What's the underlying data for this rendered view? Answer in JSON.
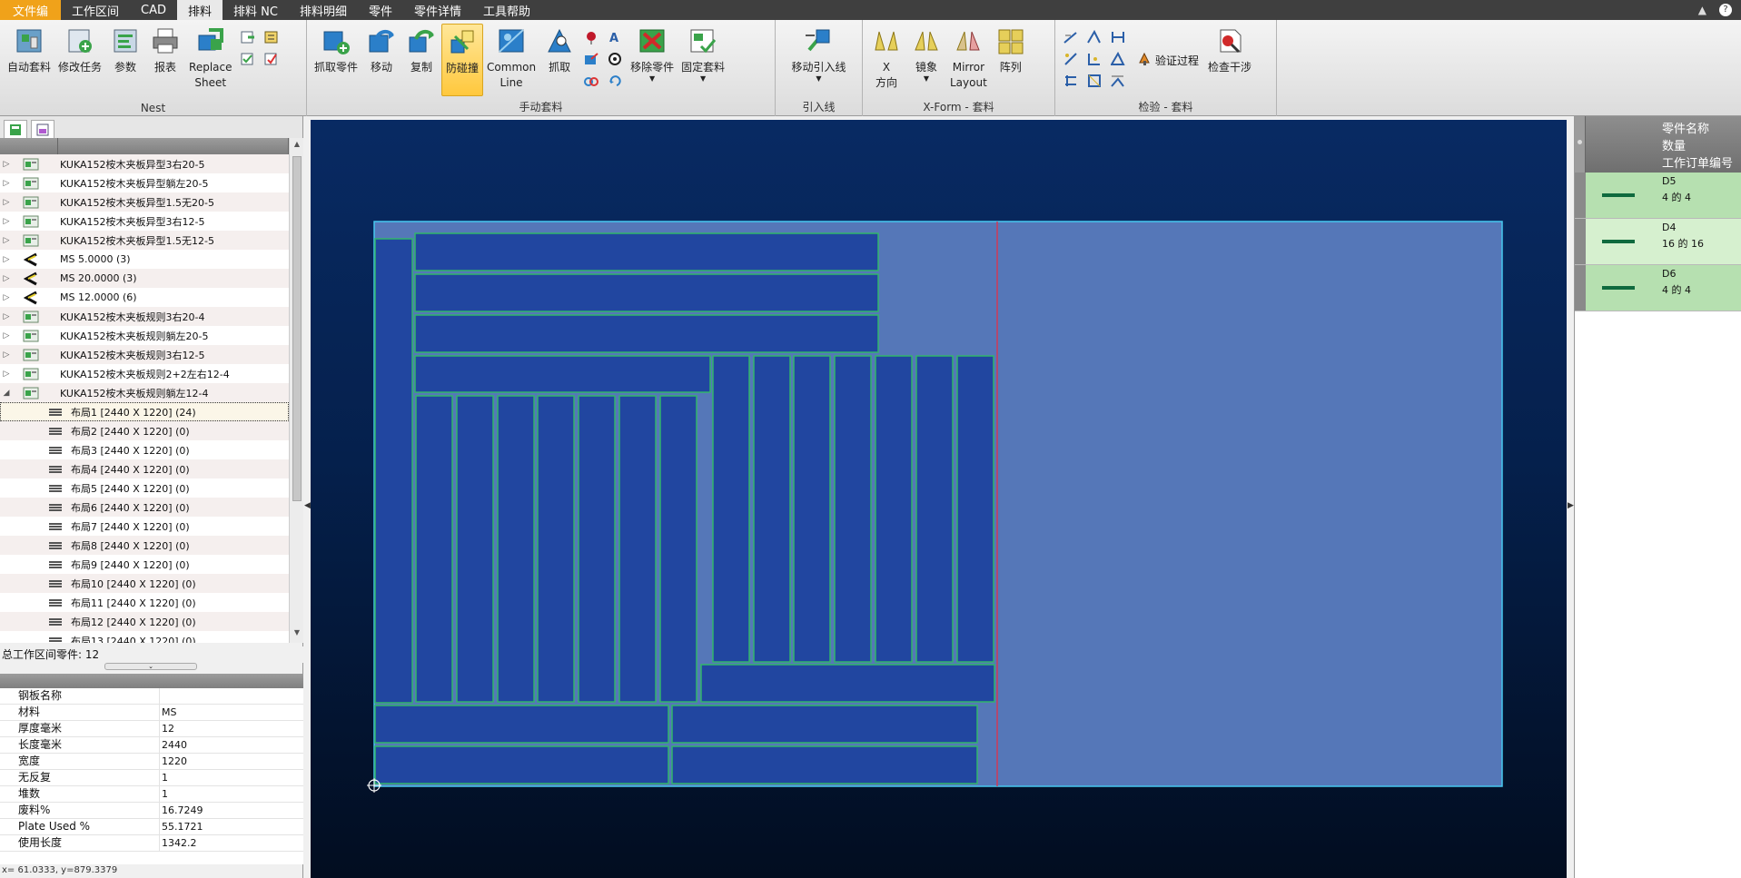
{
  "menu": {
    "tabs": [
      "文件编",
      "工作区间",
      "CAD",
      "排料",
      "排料 NC",
      "排料明细",
      "零件",
      "零件详情",
      "工具帮助"
    ],
    "active_tab": "排料"
  },
  "ribbon": {
    "groups": {
      "nest": {
        "label": "Nest",
        "auto_nest": "自动套料",
        "modify_task": "修改任务",
        "params": "参数",
        "report": "报表",
        "replace_sheet": "Replace\nSheet"
      },
      "manual": {
        "label": "手动套料",
        "grab_part": "抓取零件",
        "move": "移动",
        "copy": "复制",
        "anti_collision": "防碰撞",
        "common_line": "Common\nLine",
        "grab": "抓取",
        "remove_part": "移除零件",
        "fix_nest": "固定套料"
      },
      "leadin": {
        "label": "引入线",
        "move_leadin": "移动引入线"
      },
      "xform": {
        "label": "X-Form - 套料",
        "x_direction": "X\n方向",
        "mirror": "镜象",
        "mirror_layout": "Mirror\nLayout",
        "array": "阵列"
      },
      "check": {
        "label": "检验 - 套料",
        "verify": "验证过程",
        "check_interference": "检查干涉"
      }
    }
  },
  "tree": {
    "rows": [
      {
        "text": "KUKA152桉木夹板异型3右20-5",
        "type": "program"
      },
      {
        "text": "KUKA152桉木夹板异型躺左20-5",
        "type": "program"
      },
      {
        "text": "KUKA152桉木夹板异型1.5无20-5",
        "type": "program"
      },
      {
        "text": "KUKA152桉木夹板异型3右12-5",
        "type": "program"
      },
      {
        "text": "KUKA152桉木夹板异型1.5无12-5",
        "type": "program"
      },
      {
        "text": "MS 5.0000 (3)",
        "type": "material"
      },
      {
        "text": "MS 20.0000 (3)",
        "type": "material"
      },
      {
        "text": "MS 12.0000 (6)",
        "type": "material"
      },
      {
        "text": "KUKA152桉木夹板规则3右20-4",
        "type": "program"
      },
      {
        "text": "KUKA152桉木夹板规则躺左20-5",
        "type": "program"
      },
      {
        "text": "KUKA152桉木夹板规则3右12-5",
        "type": "program"
      },
      {
        "text": "KUKA152桉木夹板规则2+2左右12-4",
        "type": "program"
      },
      {
        "text": "KUKA152桉木夹板规则躺左12-4",
        "type": "program",
        "expanded": true
      },
      {
        "text": "布局1 [2440 X 1220]  (24)",
        "type": "layout",
        "selected": true
      },
      {
        "text": "布局2 [2440 X 1220]  (0)",
        "type": "layout"
      },
      {
        "text": "布局3 [2440 X 1220]  (0)",
        "type": "layout"
      },
      {
        "text": "布局4 [2440 X 1220]  (0)",
        "type": "layout"
      },
      {
        "text": "布局5 [2440 X 1220]  (0)",
        "type": "layout"
      },
      {
        "text": "布局6 [2440 X 1220]  (0)",
        "type": "layout"
      },
      {
        "text": "布局7 [2440 X 1220]  (0)",
        "type": "layout"
      },
      {
        "text": "布局8 [2440 X 1220]  (0)",
        "type": "layout"
      },
      {
        "text": "布局9 [2440 X 1220]  (0)",
        "type": "layout"
      },
      {
        "text": "布局10 [2440 X 1220]  (0)",
        "type": "layout"
      },
      {
        "text": "布局11 [2440 X 1220]  (0)",
        "type": "layout"
      },
      {
        "text": "布局12 [2440 X 1220]  (0)",
        "type": "layout"
      },
      {
        "text": "布局13 [2440 X 1220]  (0)",
        "type": "layout"
      }
    ],
    "total_parts_label": "总工作区间零件: 12"
  },
  "properties": {
    "section": "钢板名称",
    "rows": [
      {
        "key": "材料",
        "value": "MS"
      },
      {
        "key": "厚度毫米",
        "value": "12"
      },
      {
        "key": "长度毫米",
        "value": "2440"
      },
      {
        "key": "宽度",
        "value": "1220"
      },
      {
        "key": "无反复",
        "value": "1"
      },
      {
        "key": "堆数",
        "value": "1"
      },
      {
        "key": "废料%",
        "value": "16.7249"
      },
      {
        "key": "Plate Used %",
        "value": "55.1721"
      },
      {
        "key": "使用长度",
        "value": "1342.2"
      }
    ]
  },
  "status": {
    "coords": "x= 61.0333, y=879.3379"
  },
  "parts_panel": {
    "headers": [
      "零件名称",
      "数量",
      "工作订单编号"
    ],
    "rows": [
      {
        "name": "D5",
        "count": "4 的 4"
      },
      {
        "name": "D4",
        "count": "16 的 16"
      },
      {
        "name": "D6",
        "count": "4 的 4"
      }
    ]
  },
  "colors": {
    "sheet": "#5577b8",
    "part_fill": "#2146a0",
    "part_stroke": "#31b56a",
    "cut_line": "#d03a56",
    "plate_border": "#47c8f0",
    "parts_row_bg": "#b6e0b0",
    "parts_row_bg_alt": "#d6f0cf",
    "active_tab": "#f0a21a"
  }
}
